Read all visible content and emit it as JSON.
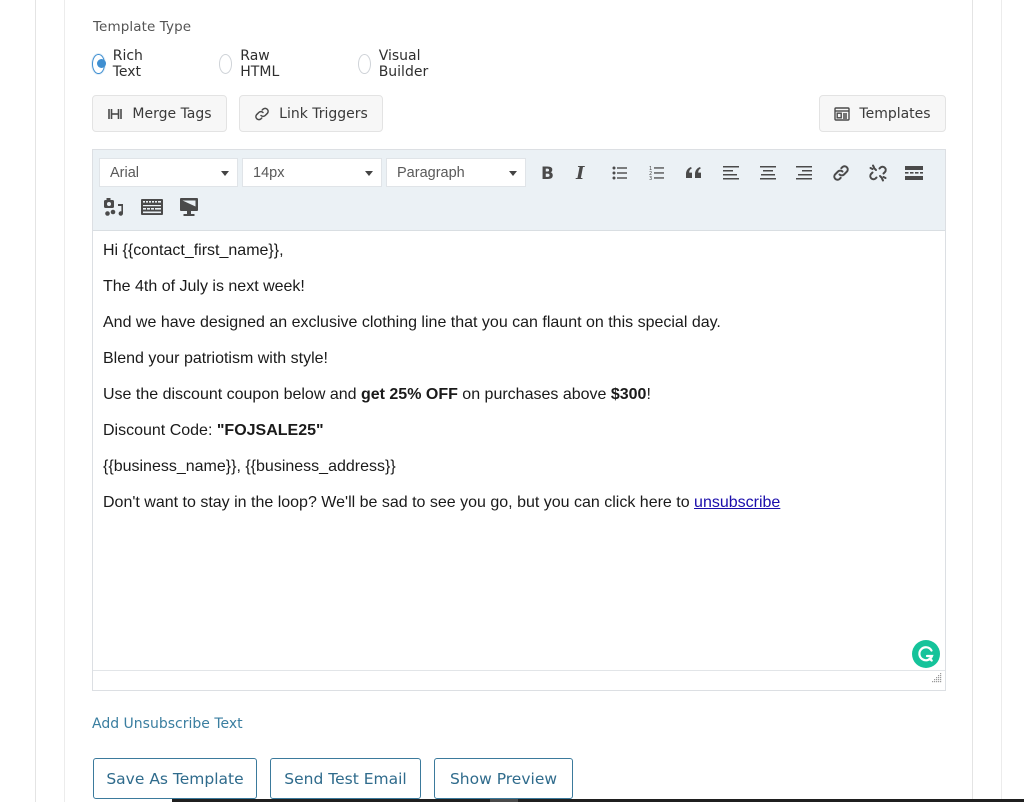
{
  "template_type": {
    "label": "Template Type",
    "options": [
      {
        "label": "Rich Text",
        "checked": true
      },
      {
        "label": "Raw HTML",
        "checked": false
      },
      {
        "label": "Visual Builder",
        "checked": false
      }
    ]
  },
  "actions": {
    "merge_tags": {
      "label": "Merge Tags",
      "icon": "merge-tags-icon"
    },
    "link_triggers": {
      "label": "Link Triggers",
      "icon": "link-icon"
    },
    "templates": {
      "label": "Templates",
      "icon": "template-icon"
    }
  },
  "toolbar": {
    "font_family": "Arial",
    "font_size": "14px",
    "block_format": "Paragraph",
    "buttons": [
      "bold",
      "italic",
      "bullet-list",
      "numbered-list",
      "blockquote",
      "align-left",
      "align-center",
      "align-right",
      "link",
      "unlink",
      "horizontal-rule",
      "insert-media",
      "keyboard-shortcuts",
      "preview"
    ]
  },
  "content": {
    "line1": "Hi {{contact_first_name}},",
    "line2": "The 4th of July is next week!",
    "line3": "And we have designed an exclusive clothing line that you can flaunt on this special day.",
    "line4": "Blend your patriotism with style!",
    "line5": {
      "pre": "Use the discount coupon below and ",
      "bold1": "get 25% OFF",
      "mid": " on purchases above ",
      "bold2": "$300",
      "post": "!"
    },
    "line6": {
      "pre": "Discount Code: ",
      "bold": "\"FOJSALE25\""
    },
    "line7": "{{business_name}}, {{business_address}}",
    "line8": {
      "pre": "Don't want to stay in the loop? We'll be sad to see you go, but you can click here to ",
      "link": "unsubscribe"
    }
  },
  "add_unsubscribe_text": "Add Unsubscribe Text",
  "footer_buttons": {
    "save_as_template": "Save As Template",
    "send_test_email": "Send Test Email",
    "show_preview": "Show Preview"
  },
  "colors": {
    "accent": "#3f8fd1",
    "button_outline": "#3b7a9c",
    "toolbar_bg": "#ebf1f5",
    "grammarly": "#15c39a",
    "link": "#1a0dab"
  }
}
